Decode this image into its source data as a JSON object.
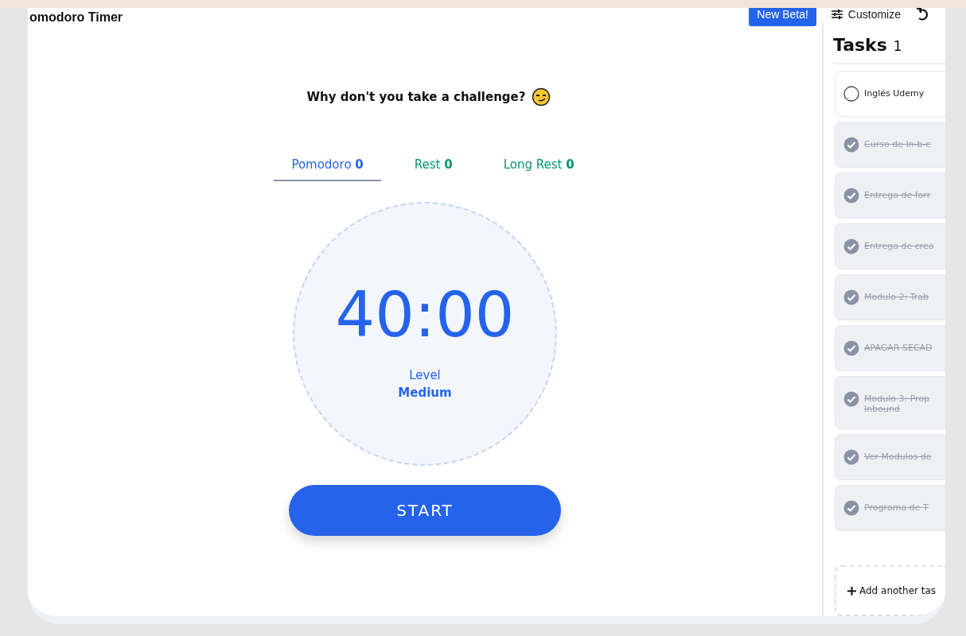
{
  "header": {
    "title": "omodoro Timer",
    "beta_button": "New Beta!",
    "customize": "Customize"
  },
  "challenge": {
    "text": "Why don't you take a challenge?"
  },
  "tabs": [
    {
      "label": "Pomodoro",
      "count": "0",
      "selected": true,
      "color": "#2563eb"
    },
    {
      "label": "Rest",
      "count": "0",
      "selected": false,
      "color": "#059669"
    },
    {
      "label": "Long Rest",
      "count": "0",
      "selected": false,
      "color": "#059669"
    }
  ],
  "timer": {
    "time": "40:00",
    "level_label": "Level",
    "level_value": "Medium"
  },
  "start_button": "START",
  "tasks": {
    "title": "Tasks",
    "count": "1",
    "items": [
      {
        "text": "Inglés Udemy",
        "done": false
      },
      {
        "text": "Curso de In-b-c",
        "done": true
      },
      {
        "text": "Entrega de forr",
        "done": true
      },
      {
        "text": "Entrega de crea",
        "done": true
      },
      {
        "text": "Modulo 2: Trab",
        "done": true
      },
      {
        "text": "APAGAR SECAD",
        "done": true
      },
      {
        "text": "Modulo 3: Prop Inbound",
        "done": true
      },
      {
        "text": "Ver Modulos de",
        "done": true
      },
      {
        "text": "Programa de T",
        "done": true
      }
    ],
    "add_button": "Add another tas"
  }
}
